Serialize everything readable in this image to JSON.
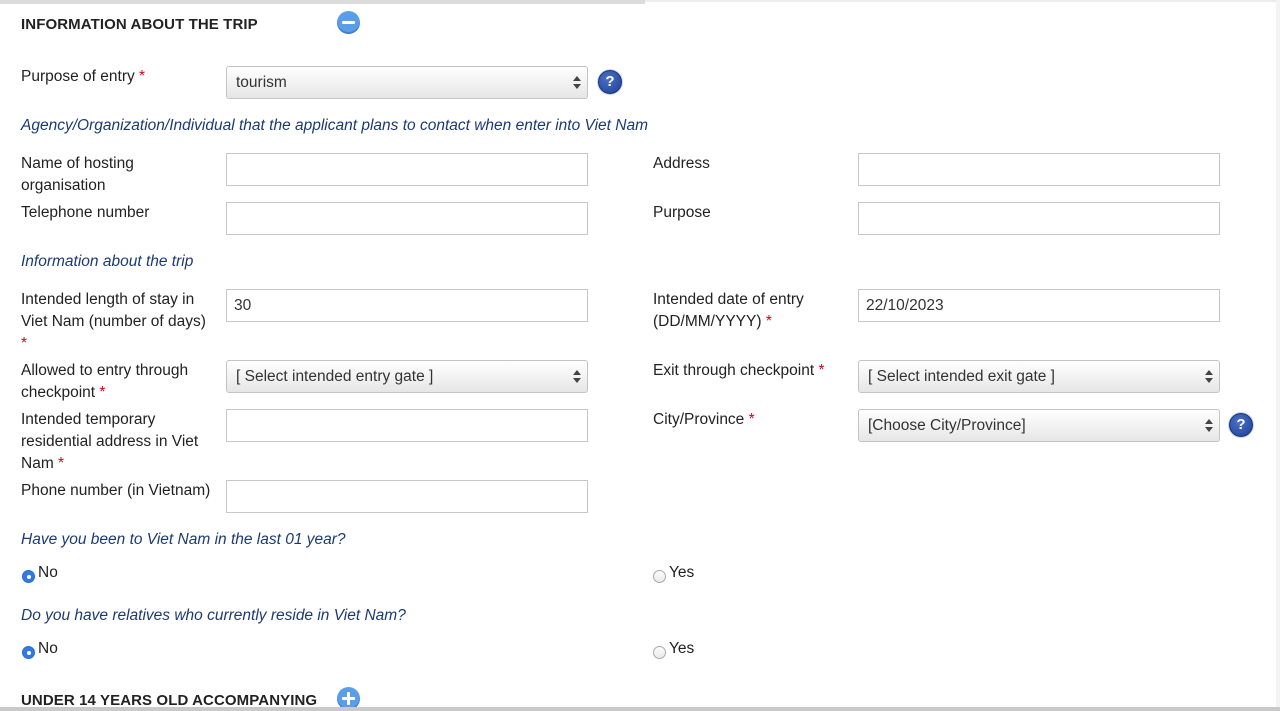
{
  "section": {
    "title": "INFORMATION ABOUT THE TRIP",
    "bottom_title": "UNDER 14 YEARS OLD ACCOMPANYING"
  },
  "purpose": {
    "label": "Purpose of entry",
    "value": "tourism"
  },
  "required_mark": "*",
  "help_glyph": "?",
  "agency": {
    "heading": "Agency/Organization/Individual that the applicant plans to contact when enter into Viet Nam",
    "name_label_1": "Name of hosting",
    "name_label_2": "organisation",
    "name_value": "",
    "address_label": "Address",
    "address_value": "",
    "phone_label": "Telephone number",
    "phone_value": "",
    "purpose_label": "Purpose",
    "purpose_value": ""
  },
  "trip": {
    "heading": "Information about the trip",
    "length_label_1": "Intended length of stay in",
    "length_label_2": "Viet Nam (number of days)",
    "length_value": "30",
    "date_label_1": "Intended date of entry",
    "date_label_2": "(DD/MM/YYYY)",
    "date_value": "22/10/2023",
    "entry_gate_label_1": "Allowed to entry through",
    "entry_gate_label_2": "checkpoint",
    "entry_gate_value": "[ Select intended entry gate ]",
    "exit_gate_label": "Exit through checkpoint",
    "exit_gate_value": "[ Select intended exit gate ]",
    "address_label_1": "Intended temporary",
    "address_label_2": "residential address in Viet",
    "address_label_3": "Nam",
    "address_value": "",
    "city_label": "City/Province",
    "city_value": "[Choose City/Province]",
    "vn_phone_label": "Phone number (in Vietnam)",
    "vn_phone_value": ""
  },
  "q1": {
    "question": "Have you been to Viet Nam in the last 01 year?",
    "no": "No",
    "yes": "Yes",
    "selected": "No"
  },
  "q2": {
    "question": "Do you have relatives who currently reside in Viet Nam?",
    "no": "No",
    "yes": "Yes",
    "selected": "No"
  },
  "colors": {
    "subheading": "#1b3a73",
    "required": "#d0021b",
    "toggle": "#5b9ee6",
    "radio_selected": "#2f7ae5"
  },
  "icons": {
    "collapse": "minus-circle-icon",
    "expand": "plus-circle-icon",
    "help": "help-question-icon"
  }
}
